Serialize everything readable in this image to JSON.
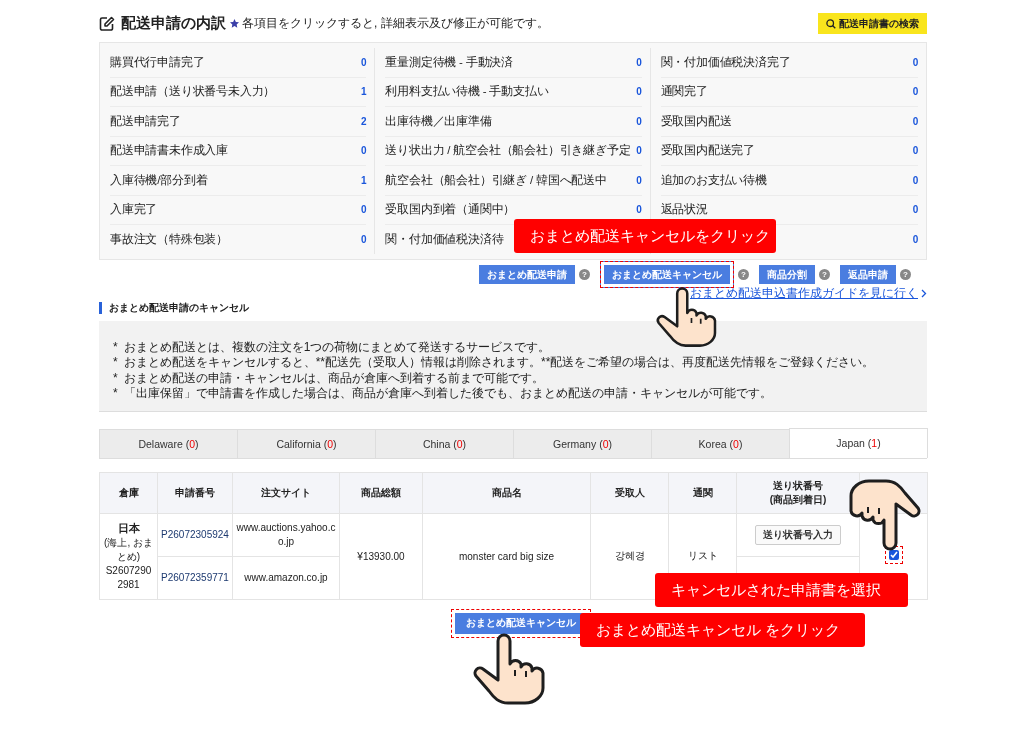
{
  "header": {
    "title": "配送申請の内訳",
    "note": "各項目をクリックすると, 詳細表示及び修正が可能です。",
    "search_button": "配送申請書の検索"
  },
  "status_columns": [
    [
      {
        "label": "購買代行申請完了",
        "value": "0"
      },
      {
        "label": "配送申請（送り状番号未入力）",
        "value": "1"
      },
      {
        "label": "配送申請完了",
        "value": "2"
      },
      {
        "label": "配送申請書未作成入庫",
        "value": "0"
      },
      {
        "label": "入庫待機/部分到着",
        "value": "1"
      },
      {
        "label": "入庫完了",
        "value": "0"
      },
      {
        "label": "事故注文（特殊包装）",
        "value": "0"
      }
    ],
    [
      {
        "label": "重量測定待機 - 手動決済",
        "value": "0"
      },
      {
        "label": "利用料支払い待機 - 手動支払い",
        "value": "0"
      },
      {
        "label": "出庫待機／出庫準備",
        "value": "0"
      },
      {
        "label": "送り状出力 / 航空会社（船会社）引き継ぎ予定",
        "value": "0"
      },
      {
        "label": "航空会社（船会社）引継ぎ / 韓国へ配送中",
        "value": "0"
      },
      {
        "label": "受取国内到着（通関中）",
        "value": "0"
      },
      {
        "label": "関・付加価値税決済待"
      }
    ],
    [
      {
        "label": "関・付加価値税決済完了",
        "value": "0"
      },
      {
        "label": "通関完了",
        "value": "0"
      },
      {
        "label": "受取国内配送",
        "value": "0"
      },
      {
        "label": "受取国内配送完了",
        "value": "0"
      },
      {
        "label": "追加のお支払い待機",
        "value": "0"
      },
      {
        "label": "返品状況",
        "value": "0"
      },
      {
        "value": "0"
      }
    ]
  ],
  "action_buttons": [
    {
      "label": "おまとめ配送申請",
      "help": "?",
      "highlighted": false
    },
    {
      "label": "おまとめ配送キャンセル",
      "help": "?",
      "highlighted": true
    },
    {
      "label": "商品分割",
      "help": "?",
      "highlighted": false
    },
    {
      "label": "返品申請",
      "help": "?",
      "highlighted": false
    }
  ],
  "guide_link": "おまとめ配送申込書作成ガイドを見に行く",
  "notice": {
    "title": "おまとめ配送申請のキャンセル",
    "items": [
      {
        "marker": "*",
        "text": "おまとめ配送とは、複数の注文を1つの荷物にまとめて発送するサービスです。"
      },
      {
        "marker": "*",
        "text": "おまとめ配送をキャンセルすると、**配送先（受取人）情報は削除されます。**配送をご希望の場合は、再度配送先情報をご登録ください。"
      },
      {
        "marker": "*",
        "text": "おまとめ配送の申請・キャンセルは、商品が倉庫へ到着する前まで可能です。"
      },
      {
        "marker": "*",
        "text": "「出庫保留」で申請書を作成した場合は、商品が倉庫へ到着した後でも、おまとめ配送の申請・キャンセルが可能です。"
      }
    ]
  },
  "tabs": [
    {
      "name": "Delaware (",
      "count": "0",
      "close": ")",
      "selected": false
    },
    {
      "name": "California (",
      "count": "0",
      "close": ")",
      "selected": false
    },
    {
      "name": "China (",
      "count": "0",
      "close": ")",
      "selected": false
    },
    {
      "name": "Germany (",
      "count": "0",
      "close": ")",
      "selected": false
    },
    {
      "name": "Korea (",
      "count": "0",
      "close": ")",
      "selected": false
    },
    {
      "name": "Japan (",
      "count": "1",
      "close": ")",
      "selected": true
    }
  ],
  "table": {
    "columns": [
      "倉庫",
      "申請番号",
      "注文サイト",
      "商品総額",
      "商品名",
      "受取人",
      "通関",
      "送り状番号\n(商品到着日)"
    ],
    "group": {
      "warehouse": "日本",
      "warehouse_note": "(海上, おまとめ)",
      "group_number": "S26072902981",
      "total": "¥13930.00",
      "product": "monster card big size",
      "recipient": "강혜경",
      "customs": "リスト",
      "tracking_button": "送り状番号入力",
      "checked": true,
      "orders": [
        {
          "number": "P26072305924",
          "site": "www.auctions.yahoo.co.jp"
        },
        {
          "number": "P26072359771",
          "site": "www.amazon.co.jp"
        }
      ]
    }
  },
  "bottom_button": "おまとめ配送キャンセル",
  "callouts": [
    "おまとめ配送キャンセルをクリック",
    "キャンセルされた申請書を選択",
    "おまとめ配送キャンセル をクリック"
  ]
}
